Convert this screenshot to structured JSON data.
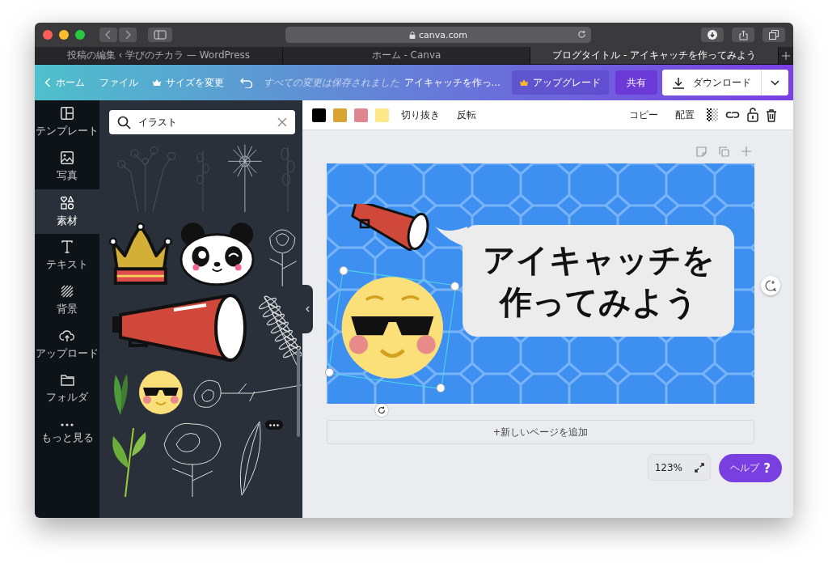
{
  "browser": {
    "url": "canva.com",
    "tabs": [
      {
        "label": "投稿の編集 ‹ 学びのチカラ — WordPress",
        "selected": false
      },
      {
        "label": "ホーム - Canva",
        "selected": false
      },
      {
        "label": "ブログタイトル - アイキャッチを作ってみよう",
        "selected": true
      }
    ]
  },
  "topbar": {
    "home": "ホーム",
    "file": "ファイル",
    "resize": "サイズを変更",
    "save_status": "すべての変更は保存されました",
    "title": "アイキャッチを作っ...",
    "upgrade": "アップグレード",
    "share": "共有",
    "download": "ダウンロード"
  },
  "sidebar": {
    "items": [
      {
        "kind": "template",
        "label": "テンプレート",
        "selected": false
      },
      {
        "kind": "photo",
        "label": "写真",
        "selected": false
      },
      {
        "kind": "elements",
        "label": "素材",
        "selected": true
      },
      {
        "kind": "text",
        "label": "テキスト",
        "selected": false
      },
      {
        "kind": "background",
        "label": "背景",
        "selected": false
      },
      {
        "kind": "upload",
        "label": "アップロード",
        "selected": false
      },
      {
        "kind": "folder",
        "label": "フォルダ",
        "selected": false
      },
      {
        "kind": "more",
        "label": "もっと見る",
        "selected": false
      }
    ]
  },
  "search": {
    "value": "イラスト"
  },
  "toolbar": {
    "colors": [
      {
        "color": "#000000"
      },
      {
        "color": "#d9a431"
      },
      {
        "color": "#de8791"
      },
      {
        "color": "#fde98a"
      }
    ],
    "left_actions": [
      "切り抜き",
      "反転"
    ],
    "right_actions": [
      "コピー",
      "配置"
    ]
  },
  "design": {
    "heading_lines": [
      "アイキャッチを",
      "作ってみよう"
    ]
  },
  "add_page": "+新しいページを追加",
  "zoom": "123%",
  "help": {
    "label": "ヘルプ",
    "mark": "?"
  }
}
